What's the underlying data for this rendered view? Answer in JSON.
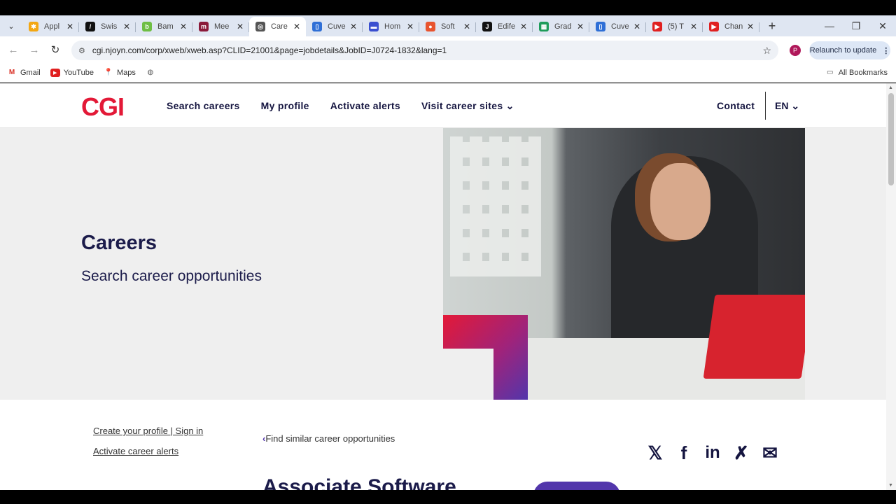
{
  "browser": {
    "tabs": [
      {
        "title": "Appl",
        "color": "#f3a712",
        "glyph": "✱"
      },
      {
        "title": "Swis",
        "color": "#111111",
        "glyph": "/"
      },
      {
        "title": "Bam",
        "color": "#6ebe44",
        "glyph": "b"
      },
      {
        "title": "Mee",
        "color": "#8b1a3a",
        "glyph": "m"
      },
      {
        "title": "Care",
        "color": "#555555",
        "glyph": "◎",
        "active": true
      },
      {
        "title": "Cuve",
        "color": "#2f6fd6",
        "glyph": "▯"
      },
      {
        "title": "Hom",
        "color": "#3a4fd0",
        "glyph": "▬"
      },
      {
        "title": "Soft",
        "color": "#e8542f",
        "glyph": "●"
      },
      {
        "title": "Edife",
        "color": "#111111",
        "glyph": "J"
      },
      {
        "title": "Grad",
        "color": "#1e9c5a",
        "glyph": "▦"
      },
      {
        "title": "Cuve",
        "color": "#2f6fd6",
        "glyph": "▯"
      },
      {
        "title": "(5) T",
        "color": "#e02020",
        "glyph": "▶"
      },
      {
        "title": "Chan",
        "color": "#e02020",
        "glyph": "▶"
      }
    ],
    "url": "cgi.njoyn.com/corp/xweb/xweb.asp?CLID=21001&page=jobdetails&JobID=J0724-1832&lang=1",
    "profile_initial": "P",
    "relaunch_label": "Relaunch to update",
    "bookmarks": [
      {
        "label": "Gmail",
        "icon": "gmail-icon"
      },
      {
        "label": "YouTube",
        "icon": "youtube-icon"
      },
      {
        "label": "Maps",
        "icon": "maps-icon"
      }
    ],
    "all_bookmarks": "All Bookmarks"
  },
  "site": {
    "logo": "CGI",
    "menu": [
      "Search careers",
      "My profile",
      "Activate alerts",
      "Visit career sites"
    ],
    "contact": "Contact",
    "lang": "EN"
  },
  "hero": {
    "title": "Careers",
    "subtitle": "Search career opportunities"
  },
  "content": {
    "create_profile": "Create your profile | Sign in",
    "activate_alerts": "Activate career alerts",
    "find_similar": "Find similar career opportunities",
    "job_title": "Associate Software",
    "social": [
      "x-icon",
      "facebook-icon",
      "linkedin-icon",
      "xing-icon",
      "email-icon"
    ]
  },
  "colors": {
    "brand_red": "#e31937",
    "brand_purple": "#5236ab",
    "navy_text": "#151540"
  }
}
